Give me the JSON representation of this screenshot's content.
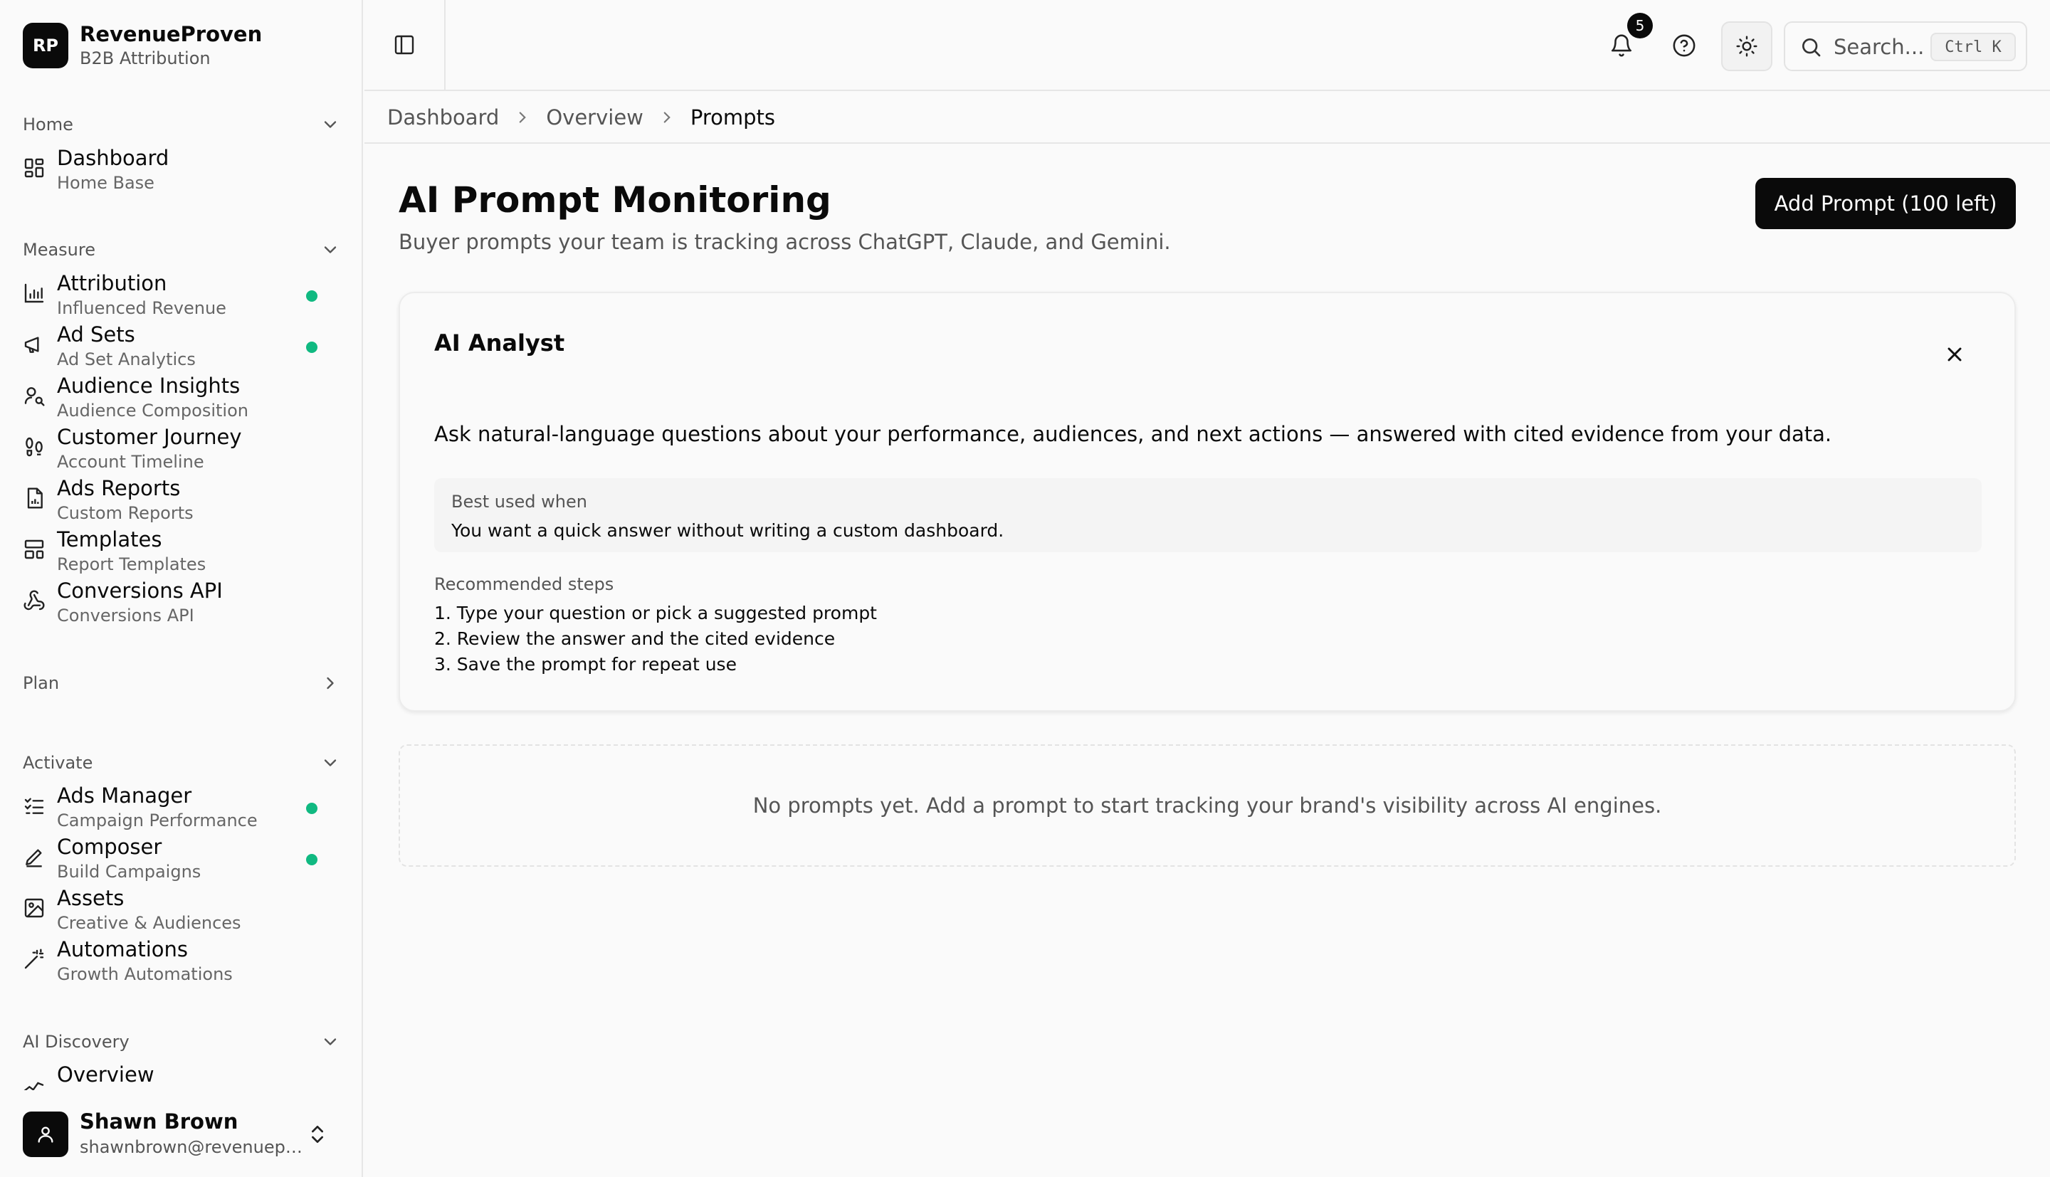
{
  "brand": {
    "logo": "RP",
    "name": "RevenueProven",
    "subtitle": "B2B Attribution"
  },
  "sidebar": {
    "sections": [
      {
        "label": "Home",
        "state": "expanded"
      },
      {
        "label": "Measure",
        "state": "expanded"
      },
      {
        "label": "Plan",
        "state": "collapsed"
      },
      {
        "label": "Activate",
        "state": "expanded"
      },
      {
        "label": "AI Discovery",
        "state": "expanded"
      }
    ],
    "items": [
      {
        "title": "Dashboard",
        "subtitle": "Home Base",
        "icon": "grid-icon",
        "status": false
      },
      {
        "title": "Attribution",
        "subtitle": "Influenced Revenue",
        "icon": "bar-chart-icon",
        "status": true
      },
      {
        "title": "Ad Sets",
        "subtitle": "Ad Set Analytics",
        "icon": "megaphone-icon",
        "status": true
      },
      {
        "title": "Audience Insights",
        "subtitle": "Audience Composition",
        "icon": "user-search-icon",
        "status": false
      },
      {
        "title": "Customer Journey",
        "subtitle": "Account Timeline",
        "icon": "footprints-icon",
        "status": false
      },
      {
        "title": "Ads Reports",
        "subtitle": "Custom Reports",
        "icon": "report-icon",
        "status": false
      },
      {
        "title": "Templates",
        "subtitle": "Report Templates",
        "icon": "layout-icon",
        "status": false
      },
      {
        "title": "Conversions API",
        "subtitle": "Conversions API",
        "icon": "webhook-icon",
        "status": false
      },
      {
        "title": "Ads Manager",
        "subtitle": "Campaign Performance",
        "icon": "list-checks-icon",
        "status": true
      },
      {
        "title": "Composer",
        "subtitle": "Build Campaigns",
        "icon": "pencil-icon",
        "status": true
      },
      {
        "title": "Assets",
        "subtitle": "Creative & Audiences",
        "icon": "image-icon",
        "status": false
      },
      {
        "title": "Automations",
        "subtitle": "Growth Automations",
        "icon": "wand-icon",
        "status": false
      },
      {
        "title": "Overview",
        "subtitle": "",
        "icon": "sparkline-icon",
        "status": false
      }
    ]
  },
  "user": {
    "name": "Shawn Brown",
    "email": "shawnbrown@revenueproven.com"
  },
  "topbar": {
    "notification_count": "5",
    "search_placeholder": "Search...",
    "search_shortcut": "Ctrl K"
  },
  "breadcrumb": [
    "Dashboard",
    "Overview",
    "Prompts"
  ],
  "page": {
    "title": "AI Prompt Monitoring",
    "subtitle": "Buyer prompts your team is tracking across ChatGPT, Claude, and Gemini.",
    "add_button": "Add Prompt (100 left)"
  },
  "card": {
    "title": "AI Analyst",
    "description": "Ask natural-language questions about your performance, audiences, and next actions — answered with cited evidence from your data.",
    "best_used_label": "Best used when",
    "best_used_text": "You want a quick answer without writing a custom dashboard.",
    "steps_label": "Recommended steps",
    "steps": [
      "1. Type your question or pick a suggested prompt",
      "2. Review the answer and the cited evidence",
      "3. Save the prompt for repeat use"
    ]
  },
  "empty_state": "No prompts yet. Add a prompt to start tracking your brand's visibility across AI engines.",
  "colors": {
    "accent": "#0a0a0a",
    "status_dot": "#10b981",
    "background": "#fafafa"
  }
}
